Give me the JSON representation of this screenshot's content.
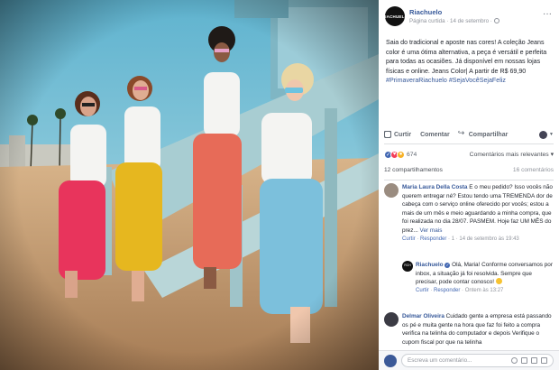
{
  "post": {
    "page_name": "Riachuelo",
    "page_logo_text": "RIACHUELO",
    "meta": "Página curtida · 14 de setembro ·",
    "more": "···",
    "text_plain": "Saia do tradicional e aposte nas cores! A coleção Jeans color é uma ótima alternativa, a peça é versátil e perfeita para todas as ocasiões. Já disponível em nossas lojas físicas e online. Jeans Color| A partir de R$ 69,90 ",
    "hashtag_1": "#PrimaveraRiachuelo",
    "hashtag_2": "#SejaVocêSejaFeliz"
  },
  "actions": {
    "like": "Curtir",
    "comment": "Comentar",
    "share": "Compartilhar"
  },
  "reactions": {
    "count": "674",
    "sort": "Comentários mais relevantes ▾"
  },
  "counts": {
    "shares": "12 compartilhamentos",
    "comments": "16 comentários"
  },
  "comments": [
    {
      "name": "Maria Laura Della Costa",
      "text": " E o meu pedido? Isso vocês não querem entregar né? Estou tendo uma TREMENDA dor de cabeça com o serviço online oferecido por vocês; estou a mais de um mês e meio aguardando a minha compra, que foi realizada no dia 28/07. PASMEM. Hoje faz UM MÊS do prez... ",
      "more": "Ver mais",
      "foot_like": "Curtir",
      "foot_reply": "Responder",
      "foot_meta": " · 1 · 14 de setembro às 19:43"
    },
    {
      "name": "Riachuelo",
      "text": " Olá, Maria! Conforme conversamos por inbox, a situação já foi resolvida. Sempre que precisar, pode contar conosco! ",
      "foot_like": "Curtir",
      "foot_reply": "Responder",
      "foot_meta": " · Ontem às 13:27"
    },
    {
      "name": "Delmar Oliveira",
      "text": " Cuidado gente a empresa está passando os pé e muita gente na hora que faz foi feito a compra verifica na telinha do computador e depois Verifique o cupom fiscal por que na telinha"
    }
  ],
  "composer": {
    "placeholder": "Escreva um comentário..."
  }
}
